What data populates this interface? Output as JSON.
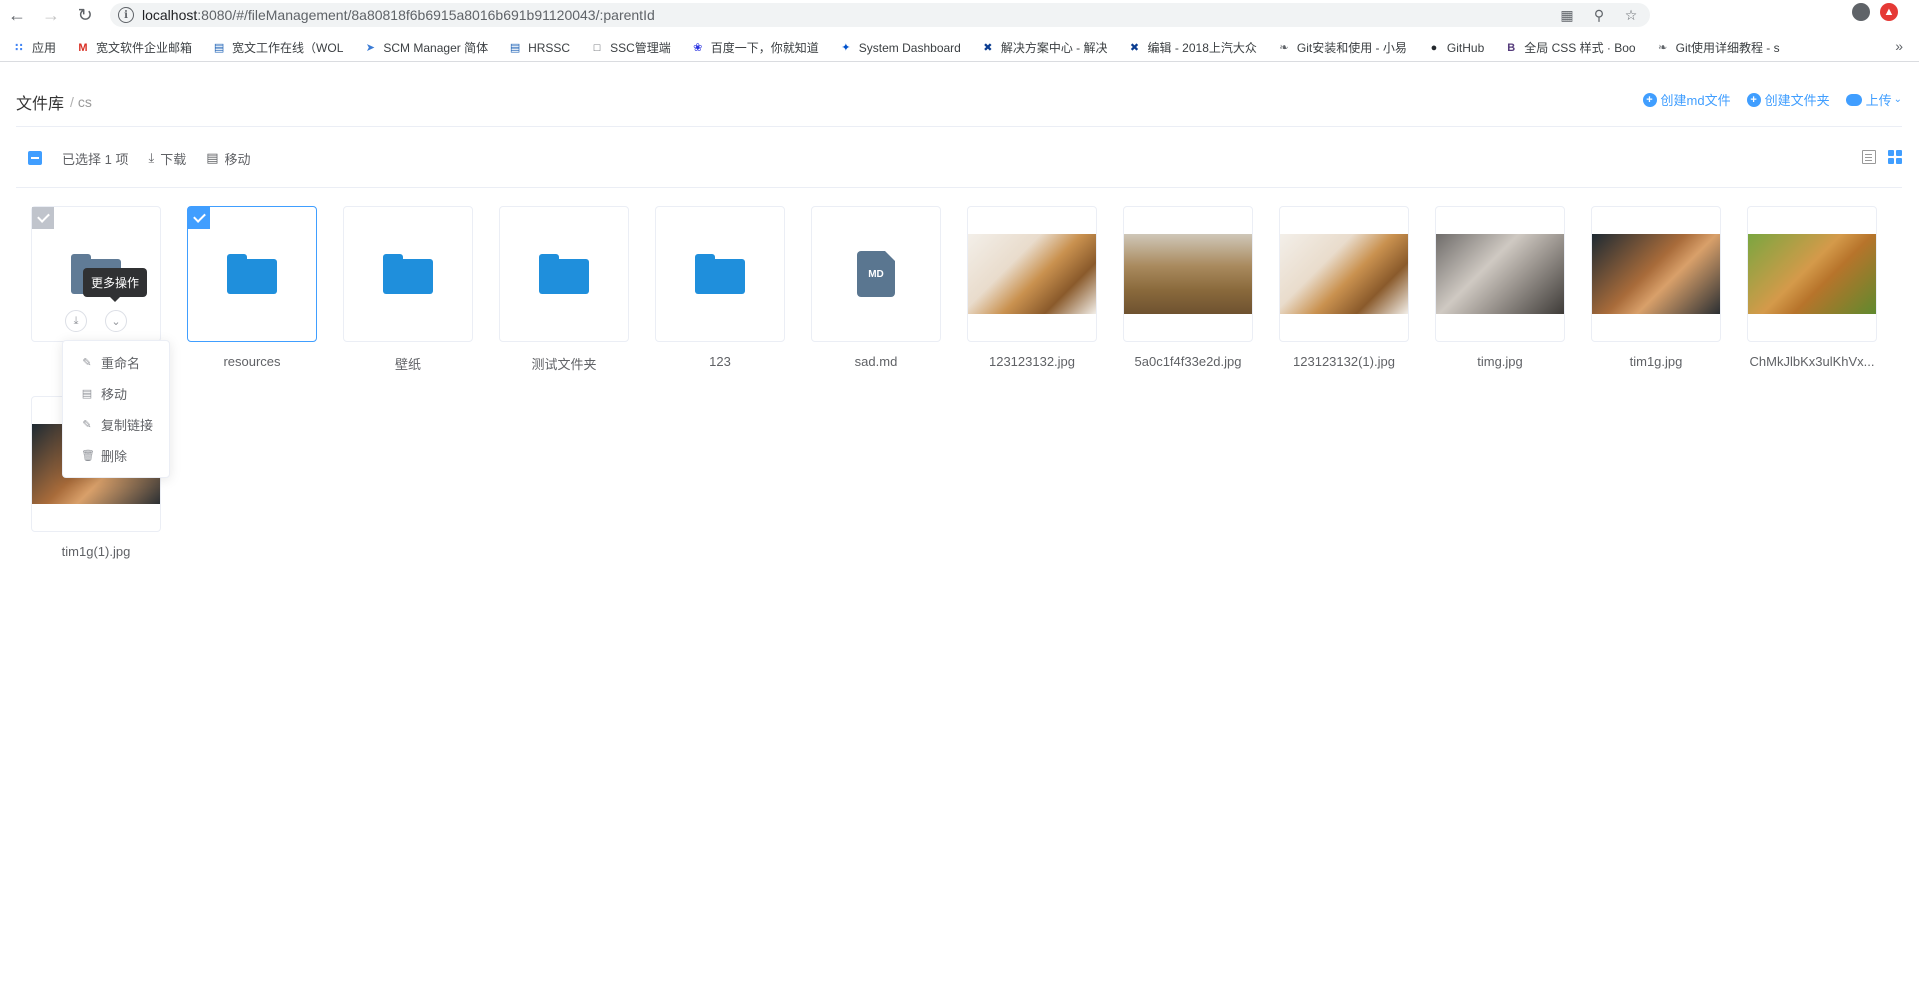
{
  "browser": {
    "url_host": "localhost",
    "url_path": ":8080/#/fileManagement/8a80818f6b6915a8016b691b91120043/:parentId",
    "bookmarks": [
      {
        "label": "应用",
        "icon": "apps-grid-icon",
        "color": "#4285f4"
      },
      {
        "label": "宽文软件企业邮箱",
        "icon": "gmail-icon",
        "color": "#d93025"
      },
      {
        "label": "宽文工作在线（WOL",
        "icon": "wol-icon",
        "color": "#1a5fb4"
      },
      {
        "label": "SCM Manager 简体",
        "icon": "scm-icon",
        "color": "#3a7bd5"
      },
      {
        "label": "HRSSC",
        "icon": "hrssc-icon",
        "color": "#1a5fb4"
      },
      {
        "label": "SSC管理端",
        "icon": "page-icon",
        "color": "#5f6368"
      },
      {
        "label": "百度一下，你就知道",
        "icon": "baidu-icon",
        "color": "#2932e1"
      },
      {
        "label": "System Dashboard",
        "icon": "jira-icon",
        "color": "#0052cc"
      },
      {
        "label": "解决方案中心 - 解决",
        "icon": "x-icon",
        "color": "#0b3d91"
      },
      {
        "label": "编辑 - 2018上汽大众",
        "icon": "x-icon",
        "color": "#0b3d91"
      },
      {
        "label": "Git安装和使用 - 小易",
        "icon": "liao-icon",
        "color": "#5f6368"
      },
      {
        "label": "GitHub",
        "icon": "github-icon",
        "color": "#24292e"
      },
      {
        "label": "全局 CSS 样式 · Boo",
        "icon": "bootstrap-icon",
        "color": "#563d7c"
      },
      {
        "label": "Git使用详细教程 - s",
        "icon": "liao-icon",
        "color": "#5f6368"
      }
    ]
  },
  "header": {
    "root": "文件库",
    "separator": "/",
    "current": "cs",
    "actions": {
      "create_md": "创建md文件",
      "create_folder": "创建文件夹",
      "upload": "上传"
    }
  },
  "toolbar": {
    "selected": "已选择 1 项",
    "download": "下载",
    "move": "移动"
  },
  "files": [
    {
      "name": "",
      "type": "folder-grey"
    },
    {
      "name": "resources",
      "type": "folder"
    },
    {
      "name": "壁纸",
      "type": "folder"
    },
    {
      "name": "测试文件夹",
      "type": "folder"
    },
    {
      "name": "123",
      "type": "folder"
    },
    {
      "name": "sad.md",
      "type": "md",
      "badge": "MD"
    },
    {
      "name": "123123132.jpg",
      "type": "image"
    },
    {
      "name": "5a0c1f4f33e2d.jpg",
      "type": "image"
    },
    {
      "name": "123123132(1).jpg",
      "type": "image"
    },
    {
      "name": "timg.jpg",
      "type": "image"
    },
    {
      "name": "tim1g.jpg",
      "type": "image"
    },
    {
      "name": "ChMkJlbKx3ulKhVx...",
      "type": "image"
    },
    {
      "name": "tim1g(1).jpg",
      "type": "image"
    }
  ],
  "tooltip": "更多操作",
  "menu": {
    "rename": "重命名",
    "move": "移动",
    "copy_link": "复制链接",
    "delete": "删除"
  },
  "colors": {
    "accent": "#409eff",
    "folder": "#1f8fdc"
  }
}
